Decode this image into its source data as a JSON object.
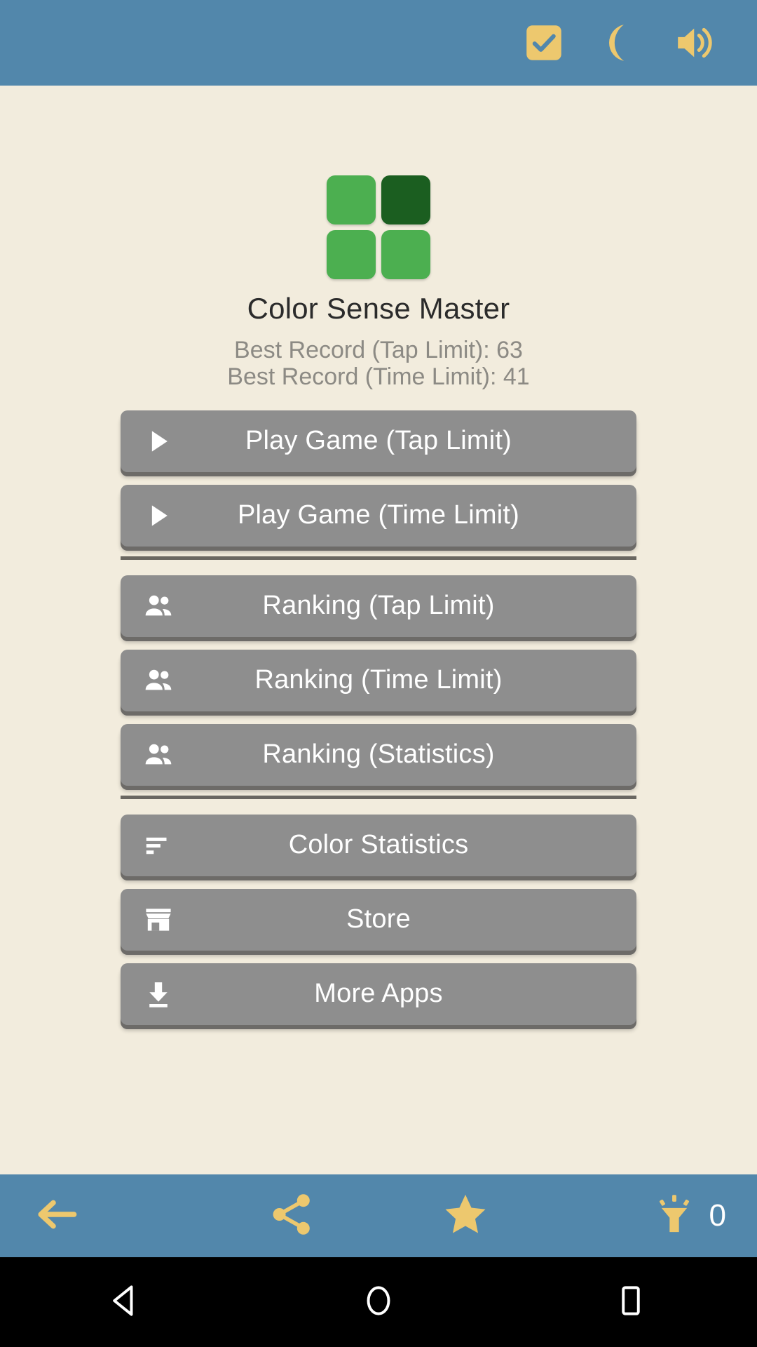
{
  "colors": {
    "bar_blue": "#5287ab",
    "accent_gold": "#edc86e",
    "background_cream": "#f2ecdd",
    "button_grey": "#8e8e8e",
    "button_shadow": "#6d6b68",
    "tile_green": "#4caf50",
    "tile_dark_green": "#1b5e20",
    "title_text": "#2b2b2b",
    "record_text": "#8c8a84",
    "divider": "#6a6761",
    "nav_black": "#000000"
  },
  "topbar": {
    "icons": [
      {
        "name": "checkbox-checked-icon",
        "label": "Checkbox"
      },
      {
        "name": "moon-icon",
        "label": "Night Mode"
      },
      {
        "name": "volume-icon",
        "label": "Sound"
      }
    ]
  },
  "header": {
    "logo_tiles": [
      "#4caf50",
      "#1b5e20",
      "#4caf50",
      "#4caf50"
    ],
    "title": "Color Sense Master",
    "records": [
      "Best Record (Tap Limit): 63",
      "Best Record (Time Limit): 41"
    ]
  },
  "menu": {
    "group_play": [
      {
        "icon": "play-icon",
        "label": "Play Game (Tap Limit)"
      },
      {
        "icon": "play-icon",
        "label": "Play Game (Time Limit)"
      }
    ],
    "group_ranking": [
      {
        "icon": "people-icon",
        "label": "Ranking (Tap Limit)"
      },
      {
        "icon": "people-icon",
        "label": "Ranking (Time Limit)"
      },
      {
        "icon": "people-icon",
        "label": "Ranking (Statistics)"
      }
    ],
    "group_extra": [
      {
        "icon": "sort-bars-icon",
        "label": "Color Statistics"
      },
      {
        "icon": "store-icon",
        "label": "Store"
      },
      {
        "icon": "download-icon",
        "label": "More Apps"
      }
    ]
  },
  "bottombar": {
    "back": {
      "icon": "arrow-left-icon",
      "label": "Back"
    },
    "share": {
      "icon": "share-icon",
      "label": "Share"
    },
    "rate": {
      "icon": "star-icon",
      "label": "Rate"
    },
    "hint": {
      "icon": "hint-bulb-icon",
      "count": "0"
    }
  },
  "navbar": {
    "back": "back-triangle-icon",
    "home": "home-circle-icon",
    "recents": "recents-square-icon"
  }
}
